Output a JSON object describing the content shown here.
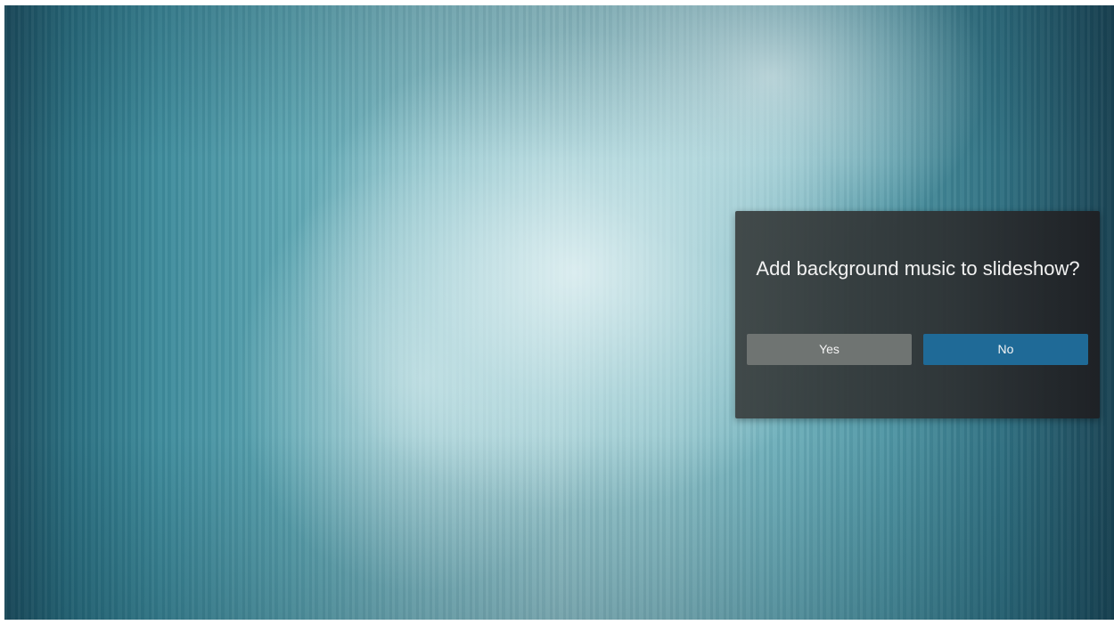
{
  "dialog": {
    "question": "Add background music to slideshow?",
    "yes_label": "Yes",
    "no_label": "No",
    "focused_button": "No"
  },
  "colors": {
    "dialog_background": "#33383a",
    "yes_button": "#6f7472",
    "no_button_focused": "#1f6a97",
    "background_accent": "#5fa7b3"
  }
}
